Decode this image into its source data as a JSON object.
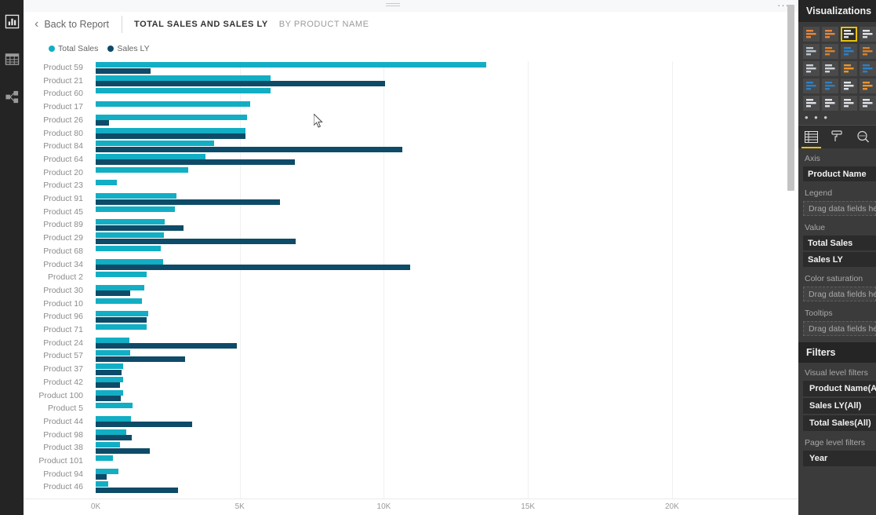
{
  "window": {
    "drag_handle": "drag-handle",
    "more_menu": "···"
  },
  "left_rail": {
    "items": [
      {
        "name": "report-view",
        "icon": "bar-chart-icon",
        "selected": true
      },
      {
        "name": "data-view",
        "icon": "table-icon",
        "selected": false
      },
      {
        "name": "model-view",
        "icon": "relationships-icon",
        "selected": false
      }
    ]
  },
  "header": {
    "back_label": "Back to Report",
    "back_icon": "chevron-left-icon",
    "title": "TOTAL SALES AND SALES LY",
    "subtitle": "BY PRODUCT NAME"
  },
  "legend": [
    {
      "label": "Total Sales",
      "color": "#12AEC4"
    },
    {
      "label": "Sales LY",
      "color": "#0E4B68"
    }
  ],
  "colors": {
    "total_sales": "#12AEC4",
    "sales_ly": "#0E4B68",
    "accent_yellow": "#E8C20A",
    "pane_bg": "#3B3B3B",
    "pane_header_bg": "#252526"
  },
  "chart_data": {
    "type": "bar",
    "orientation": "horizontal",
    "title": "TOTAL SALES AND SALES LY",
    "subtitle": "BY PRODUCT NAME",
    "xlabel": "",
    "ylabel": "Product Name",
    "xlim": [
      0,
      21500
    ],
    "xticks": [
      0,
      5000,
      10000,
      15000,
      20000
    ],
    "xticklabels": [
      "0K",
      "5K",
      "10K",
      "15K",
      "20K"
    ],
    "grid": true,
    "legend_position": "top-left",
    "categories": [
      "Product 59",
      "Product 21",
      "Product 60",
      "Product 17",
      "Product 26",
      "Product 80",
      "Product 84",
      "Product 64",
      "Product 20",
      "Product 23",
      "Product 91",
      "Product 45",
      "Product 89",
      "Product 29",
      "Product 68",
      "Product 34",
      "Product 2",
      "Product 30",
      "Product 10",
      "Product 96",
      "Product 71",
      "Product 24",
      "Product 57",
      "Product 37",
      "Product 42",
      "Product 100",
      "Product 5",
      "Product 44",
      "Product 98",
      "Product 38",
      "Product 101",
      "Product 94",
      "Product 46"
    ],
    "series": [
      {
        "name": "Total Sales",
        "color": "#12AEC4",
        "values": [
          13560,
          6060,
          6060,
          5350,
          5250,
          5200,
          4100,
          3800,
          3200,
          740,
          2800,
          2750,
          2400,
          2380,
          2250,
          2350,
          1780,
          1700,
          1600,
          1830,
          1760,
          1180,
          1200,
          940,
          940,
          960,
          1290,
          1220,
          1050,
          850,
          610,
          800,
          430
        ]
      },
      {
        "name": "Sales LY",
        "color": "#0E4B68",
        "values": [
          1900,
          10050,
          0,
          0,
          460,
          5200,
          10650,
          6900,
          0,
          0,
          6400,
          0,
          3050,
          6930,
          0,
          10900,
          0,
          1200,
          0,
          1780,
          0,
          4900,
          3100,
          900,
          840,
          870,
          0,
          3350,
          1250,
          1870,
          0,
          390,
          2860
        ]
      }
    ]
  },
  "chart_scroll": {
    "name": "chart-vertical-scrollbar",
    "thumb_top_pct": 1,
    "thumb_height_pct": 41
  },
  "visualizations_pane": {
    "title": "Visualizations",
    "icons": [
      "stacked-bar-chart-icon",
      "stacked-column-chart-icon",
      "clustered-bar-chart-icon",
      "clustered-column-chart-icon",
      "line-chart-icon",
      "area-chart-icon",
      "stacked-area-chart-icon",
      "line-and-column-chart-icon",
      "ribbon-chart-icon",
      "scatter-chart-icon",
      "pie-chart-icon",
      "donut-chart-icon",
      "treemap-icon",
      "map-icon",
      "funnel-icon",
      "gauge-icon",
      "card-icon",
      "kpi-icon",
      "table-icon",
      "matrix-icon"
    ],
    "selected_index": 2,
    "more_label": "• • •",
    "field_tabs": [
      {
        "name": "fields-tab",
        "icon": "fields-icon",
        "selected": true
      },
      {
        "name": "format-tab",
        "icon": "paint-roller-icon",
        "selected": false
      },
      {
        "name": "analytics-tab",
        "icon": "magnifier-icon",
        "selected": false
      }
    ],
    "wells": [
      {
        "label": "Axis",
        "chips": [
          "Product Name"
        ],
        "placeholder": null
      },
      {
        "label": "Legend",
        "chips": [],
        "placeholder": "Drag data fields here"
      },
      {
        "label": "Value",
        "chips": [
          "Total Sales",
          "Sales LY"
        ],
        "placeholder": null
      },
      {
        "label": "Color saturation",
        "chips": [],
        "placeholder": "Drag data fields here"
      },
      {
        "label": "Tooltips",
        "chips": [],
        "placeholder": "Drag data fields here"
      }
    ]
  },
  "filters_pane": {
    "title": "Filters",
    "groups": [
      {
        "label": "Visual level filters",
        "items": [
          "Product Name(All)",
          "Sales LY(All)",
          "Total Sales(All)"
        ]
      },
      {
        "label": "Page level filters",
        "items": [
          "Year"
        ]
      }
    ]
  }
}
